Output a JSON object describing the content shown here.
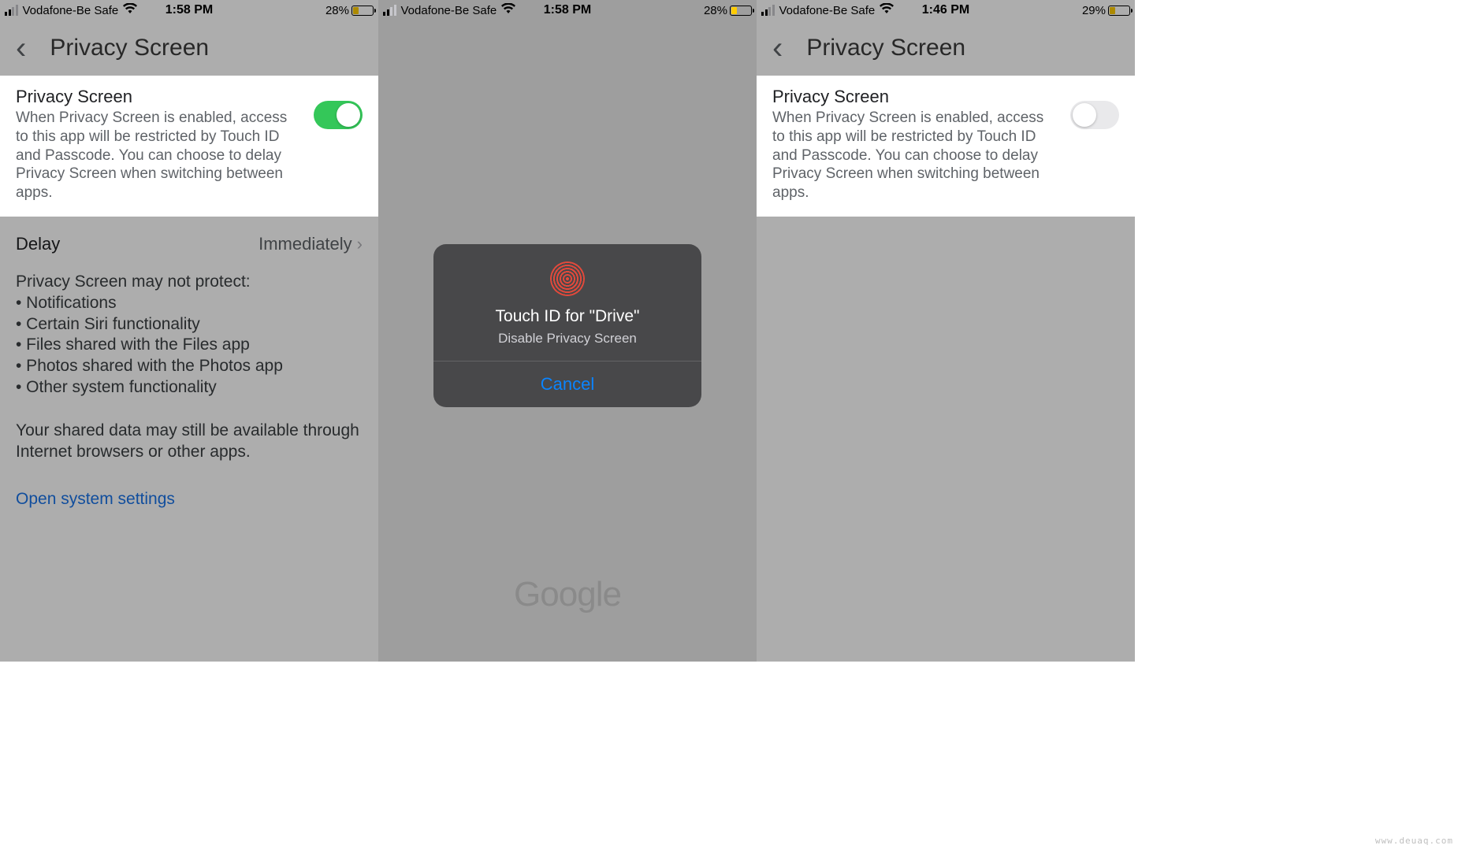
{
  "screens": {
    "left": {
      "statusbar": {
        "carrier": "Vodafone-Be Safe",
        "time": "1:58 PM",
        "battery_pct": "28%"
      },
      "nav_title": "Privacy Screen",
      "card": {
        "title": "Privacy Screen",
        "desc": "When Privacy Screen is enabled, access to this app will be restricted by Touch ID and Passcode. You can choose to delay Privacy Screen when switching between apps.",
        "toggle_on": true
      },
      "delay_label": "Delay",
      "delay_value": "Immediately",
      "info_heading": "Privacy Screen may not protect:",
      "info_bullets": [
        "Notifications",
        "Certain Siri functionality",
        "Files shared with the Files app",
        "Photos shared with the Photos app",
        "Other system functionality"
      ],
      "info_footer": "Your shared data may still be available through Internet browsers or other apps.",
      "open_settings": "Open system settings"
    },
    "middle": {
      "statusbar": {
        "carrier": "Vodafone-Be Safe",
        "time": "1:58 PM",
        "battery_pct": "28%"
      },
      "logo": "Google",
      "modal": {
        "title": "Touch ID for \"Drive\"",
        "subtitle": "Disable Privacy Screen",
        "cancel": "Cancel"
      }
    },
    "right": {
      "statusbar": {
        "carrier": "Vodafone-Be Safe",
        "time": "1:46 PM",
        "battery_pct": "29%"
      },
      "nav_title": "Privacy Screen",
      "card": {
        "title": "Privacy Screen",
        "desc": "When Privacy Screen is enabled, access to this app will be restricted by Touch ID and Passcode. You can choose to delay Privacy Screen when switching between apps.",
        "toggle_on": false
      }
    }
  },
  "bullet_prefix": "• ",
  "watermark": "www.deuaq.com"
}
